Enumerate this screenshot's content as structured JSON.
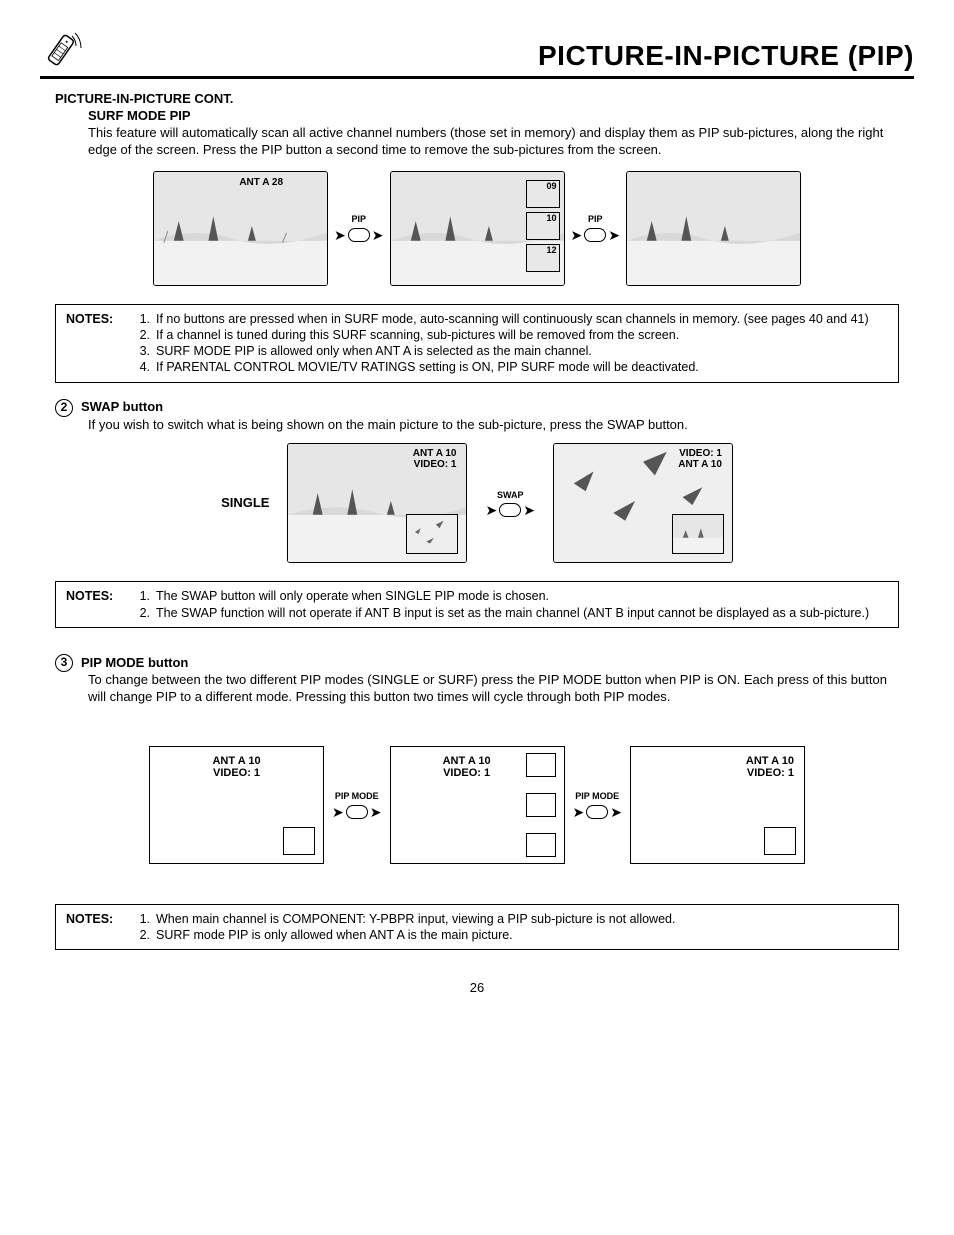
{
  "header": {
    "title": "PICTURE-IN-PICTURE (PIP)"
  },
  "sections": {
    "cont_heading": "PICTURE-IN-PICTURE CONT.",
    "surf_heading": "SURF MODE PIP",
    "surf_body": "This feature will automatically scan all active channel numbers (those set in memory) and display them as PIP sub-pictures, along the right edge of the screen.  Press the PIP button a second time to remove the sub-pictures from the screen.",
    "surf_notes_label": "NOTES:",
    "surf_notes": [
      {
        "n": "1.",
        "t": "If no buttons are pressed when in SURF mode, auto-scanning will continuously scan channels in memory.  (see pages 40 and 41)"
      },
      {
        "n": "2.",
        "t": "If a channel is tuned during this SURF scanning, sub-pictures will be removed from the screen."
      },
      {
        "n": "3.",
        "t": "SURF MODE PIP is allowed only when ANT A is selected as the main channel."
      },
      {
        "n": "4.",
        "t": "If PARENTAL CONTROL MOVIE/TV RATINGS setting is ON, PIP SURF mode will be deactivated."
      }
    ],
    "swap_num": "2",
    "swap_title": "SWAP button",
    "swap_body": "If you wish to switch what is being shown on the main picture to the sub-picture, press the SWAP button.",
    "swap_notes_label": "NOTES:",
    "swap_notes": [
      {
        "n": "1.",
        "t": "The SWAP button will only operate when SINGLE PIP mode is chosen."
      },
      {
        "n": "2.",
        "t": "The SWAP function will not operate if ANT B input is set as the main channel (ANT B input cannot be displayed as a sub-picture.)"
      }
    ],
    "mode_num": "3",
    "mode_title": "PIP MODE button",
    "mode_body": "To change between the two different PIP modes (SINGLE or SURF) press the PIP MODE button when PIP is ON.  Each press of this button will change PIP to a different mode.  Pressing this button two times will cycle through both PIP modes.",
    "mode_notes_label": "NOTES:",
    "mode_notes": [
      {
        "n": "1.",
        "t": "When main channel is COMPONENT: Y-PBPR input, viewing a PIP sub-picture is not allowed."
      },
      {
        "n": "2.",
        "t": "SURF mode PIP is only allowed when ANT A is the main picture."
      }
    ]
  },
  "diagrams": {
    "surf_osd1": "ANT A   28",
    "pip_btn": "PIP",
    "pip_nums": [
      "09",
      "10",
      "12"
    ],
    "single_label": "SINGLE",
    "swap_left_l1": "ANT A 10",
    "swap_left_l2": "VIDEO: 1",
    "swap_btn": "SWAP",
    "swap_right_l1": "VIDEO: 1",
    "swap_right_l2": "ANT  A 10",
    "mode_l1": "ANT A 10",
    "mode_l2": "VIDEO: 1",
    "mode_btn": "PIP MODE"
  },
  "page_number": "26"
}
